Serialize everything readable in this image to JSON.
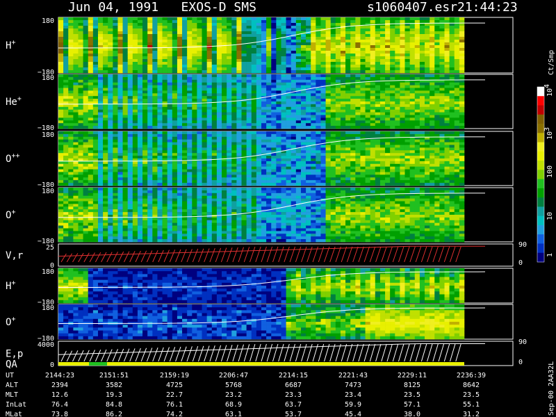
{
  "header": {
    "date_instrument": "Jun 04, 1991   EXOS-D SMS",
    "file": "s1060407.esr",
    "time": "21:44:23"
  },
  "palette": [
    "#000078",
    "#00007f",
    "#0030c0",
    "#1060e0",
    "#20a0e0",
    "#00c0c0",
    "#10a0a0",
    "#008040",
    "#00a000",
    "#20c020",
    "#80d000",
    "#c0e000",
    "#e8f000",
    "#f0f020",
    "#c0b000",
    "#8a7000",
    "#806000",
    "#c00000",
    "#ff0000",
    "#ffffff"
  ],
  "colorbar": {
    "unit": "Ct/Smp",
    "labels": [
      "1",
      "10",
      "100",
      "10",
      "3",
      "10",
      "4"
    ],
    "ticks": [
      {
        "text": "10",
        "sup": "4"
      },
      {
        "text": "10",
        "sup": "3"
      },
      {
        "text": "100",
        "sup": ""
      },
      {
        "text": "10",
        "sup": ""
      },
      {
        "text": "1",
        "sup": ""
      }
    ]
  },
  "chart_data": {
    "type": "heatmap",
    "panels": [
      {
        "label": "H",
        "sup": "+",
        "ymax": "180",
        "ymin": "−180"
      },
      {
        "label": "He",
        "sup": "+",
        "ymax": "180",
        "ymin": "−180"
      },
      {
        "label": "O",
        "sup": "++",
        "ymax": "180",
        "ymin": "−180"
      },
      {
        "label": "O",
        "sup": "+",
        "ymax": "180",
        "ymin": "−180"
      },
      {
        "label": "V,r",
        "sup": "",
        "ymax": "25",
        "ymin": "0",
        "right_top": "90",
        "right_bottom": "0"
      },
      {
        "label": "H",
        "sup": "+",
        "ymax": "180",
        "ymin": "−180"
      },
      {
        "label": "O",
        "sup": "+",
        "ymax": "180",
        "ymin": "−180"
      },
      {
        "label": "E,p",
        "sup": "",
        "label2": "QA",
        "ymax": "4000",
        "ymin": "0",
        "right_top": "90",
        "right_bottom": "0"
      }
    ],
    "time_table": {
      "row_labels": [
        "UT",
        "ALT",
        "MLT",
        "InLat",
        "MLat"
      ],
      "columns": [
        {
          "UT": "2144:23",
          "ALT": "2394",
          "MLT": "12.6",
          "InLat": "76.4",
          "MLat": "73.8"
        },
        {
          "UT": "2151:51",
          "ALT": "3582",
          "MLT": "19.3",
          "InLat": "84.8",
          "MLat": "86.2"
        },
        {
          "UT": "2159:19",
          "ALT": "4725",
          "MLT": "22.7",
          "InLat": "76.1",
          "MLat": "74.2"
        },
        {
          "UT": "2206:47",
          "ALT": "5768",
          "MLT": "23.2",
          "InLat": "68.9",
          "MLat": "63.1"
        },
        {
          "UT": "2214:15",
          "ALT": "6687",
          "MLT": "23.3",
          "InLat": "63.7",
          "MLat": "53.7"
        },
        {
          "UT": "2221:43",
          "ALT": "7473",
          "MLT": "23.4",
          "InLat": "59.9",
          "MLat": "45.4"
        },
        {
          "UT": "2229:11",
          "ALT": "8125",
          "MLT": "23.5",
          "InLat": "57.1",
          "MLat": "38.0"
        },
        {
          "UT": "2236:39",
          "ALT": "8642",
          "MLT": "23.5",
          "InLat": "55.1",
          "MLat": "31.2"
        }
      ]
    }
  },
  "footer_stamp": "Sep-00  2AA32L"
}
